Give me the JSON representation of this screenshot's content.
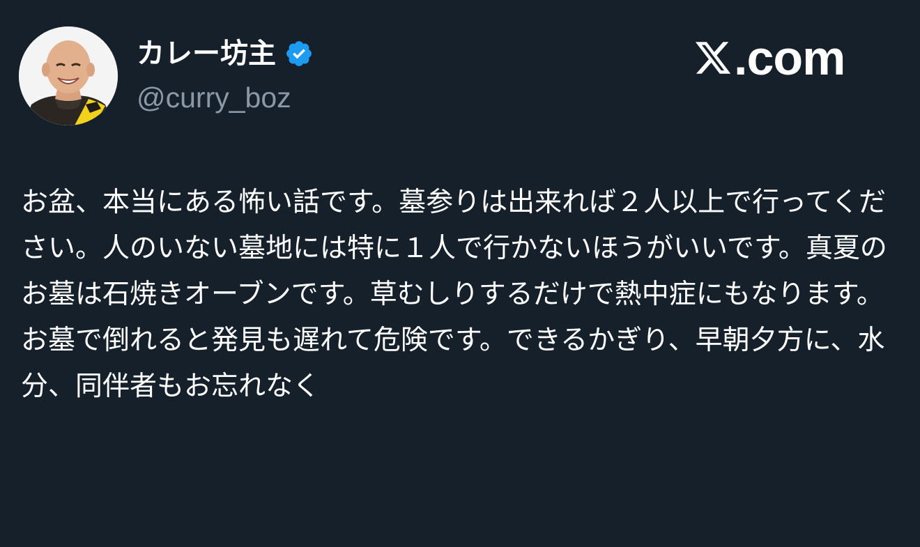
{
  "author": {
    "display_name": "カレー坊主",
    "handle": "@curry_boz",
    "verified": true,
    "avatar": "profile-photo"
  },
  "brand": {
    "text": ".com",
    "logo": "x-logo"
  },
  "tweet": {
    "text": "お盆、本当にある怖い話です。墓参りは出来れば２人以上で行ってください。人のいない墓地には特に１人で行かないほうがいいです。真夏のお墓は石焼きオーブンです。草むしりするだけで熱中症にもなります。お墓で倒れると発見も遅れて危険です。できるかぎり、早朝夕方に、水分、同伴者もお忘れなく"
  },
  "colors": {
    "background": "#15202b",
    "text": "#ffffff",
    "handle": "#8b98a5",
    "verified_badge": "#1d9bf0"
  }
}
